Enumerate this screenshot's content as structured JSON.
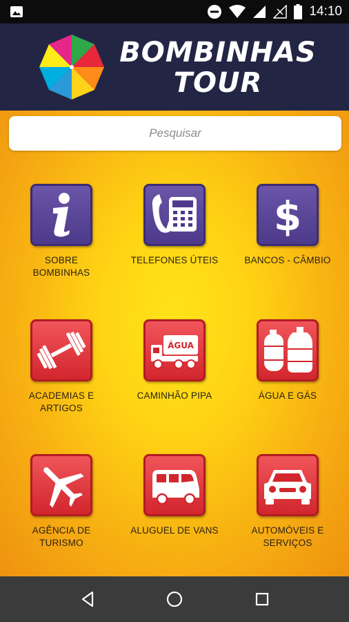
{
  "status_bar": {
    "time": "14:10",
    "icons": [
      "image-icon",
      "do-not-disturb-icon",
      "wifi-icon",
      "signal-icon",
      "signal-icon-empty",
      "battery-icon"
    ]
  },
  "header": {
    "brand_line1": "BOMBINHAS",
    "brand_line2": "TOUR",
    "logo_icon": "umbrella-icon"
  },
  "search": {
    "placeholder": "Pesquisar",
    "value": ""
  },
  "tiles": [
    {
      "label": "SOBRE\nBOMBINHAS",
      "icon": "info-icon",
      "color": "purple"
    },
    {
      "label": "TELEFONES ÚTEIS",
      "icon": "telephone-icon",
      "color": "purple"
    },
    {
      "label": "BANCOS - CÂMBIO",
      "icon": "dollar-icon",
      "color": "purple"
    },
    {
      "label": "ACADEMIAS E\nARTIGOS",
      "icon": "dumbbell-icon",
      "color": "red"
    },
    {
      "label": "CAMINHÃO PIPA",
      "icon": "water-truck-icon",
      "color": "red"
    },
    {
      "label": "ÁGUA E GÁS",
      "icon": "gas-water-icon",
      "color": "red"
    },
    {
      "label": "AGÊNCIA DE\nTURISMO",
      "icon": "airplane-icon",
      "color": "red"
    },
    {
      "label": "ALUGUEL DE VANS",
      "icon": "van-icon",
      "color": "red"
    },
    {
      "label": "AUTOMÓVEIS E\nSERVIÇOS",
      "icon": "car-icon",
      "color": "red"
    }
  ],
  "water_truck_text": "ÁGUA",
  "nav": {
    "icons": [
      "back-icon",
      "home-icon",
      "recents-icon"
    ]
  },
  "colors": {
    "header_bg": "#232544",
    "purple_tile": "#4d3a8a",
    "red_tile": "#d2262d",
    "background_center": "#ffe21a",
    "background_edge": "#ee9210"
  }
}
